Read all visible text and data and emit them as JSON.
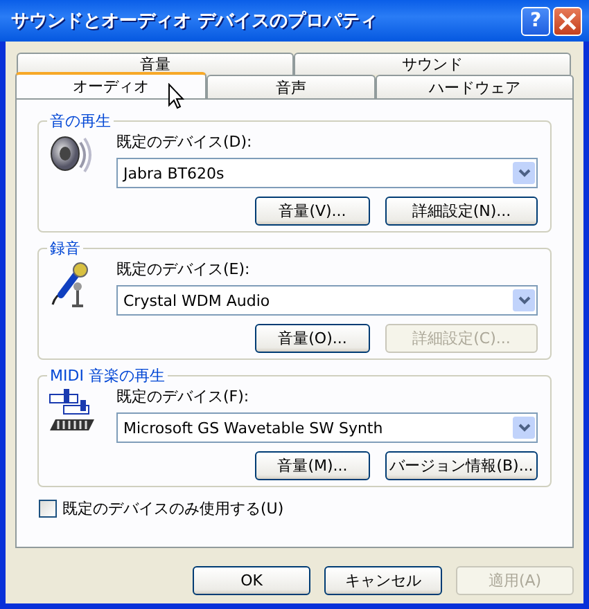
{
  "window": {
    "title": "サウンドとオーディオ デバイスのプロパティ",
    "help_button": "?"
  },
  "tab_rows": [
    [
      {
        "label": "音量",
        "selected": false
      },
      {
        "label": "サウンド",
        "selected": false
      }
    ],
    [
      {
        "label": "オーディオ",
        "selected": true
      },
      {
        "label": "音声",
        "selected": false
      },
      {
        "label": "ハードウェア",
        "selected": false
      }
    ]
  ],
  "groups": [
    {
      "title": "音の再生",
      "kind": "speaker",
      "device_label": "既定のデバイス(D):",
      "device": "Jabra BT620s",
      "buttons": [
        {
          "label": "音量(V)...",
          "disabled": false
        },
        {
          "label": "詳細設定(N)...",
          "disabled": false
        }
      ]
    },
    {
      "title": "録音",
      "kind": "microphone",
      "device_label": "既定のデバイス(E):",
      "device": "Crystal WDM Audio",
      "buttons": [
        {
          "label": "音量(O)...",
          "disabled": false
        },
        {
          "label": "詳細設定(C)...",
          "disabled": true
        }
      ]
    },
    {
      "title": "MIDI 音楽の再生",
      "kind": "midi",
      "device_label": "既定のデバイス(F):",
      "device": "Microsoft GS Wavetable SW Synth",
      "buttons": [
        {
          "label": "音量(M)...",
          "disabled": false
        },
        {
          "label": "バージョン情報(B)...",
          "disabled": false
        }
      ]
    }
  ],
  "default_only": {
    "label": "既定のデバイスのみ使用する(U)",
    "checked": false
  },
  "footer_buttons": [
    {
      "label": "OK",
      "disabled": false
    },
    {
      "label": "キャンセル",
      "disabled": false
    },
    {
      "label": "適用(A)",
      "disabled": true
    }
  ]
}
